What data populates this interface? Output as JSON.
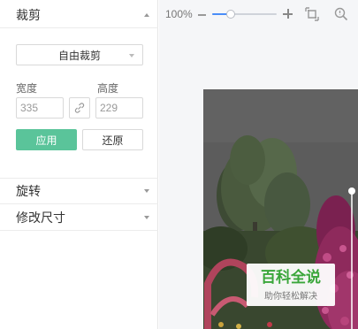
{
  "sidebar": {
    "crop": {
      "title": "裁剪",
      "mode": "自由裁剪",
      "width_label": "宽度",
      "width_value": "335",
      "height_label": "高度",
      "height_value": "229",
      "apply_label": "应用",
      "reset_label": "还原"
    },
    "rotate": {
      "title": "旋转"
    },
    "resize": {
      "title": "修改尺寸"
    }
  },
  "toolbar": {
    "zoom": "100%",
    "zoom_level": 0.25
  },
  "watermark": {
    "title": "百科全说",
    "subtitle": "助你轻松解决"
  },
  "icons": [
    "chevron-up-icon",
    "chevron-down-icon",
    "link-icon",
    "crop-icon",
    "zoom-icon",
    "minus-icon",
    "plus-icon"
  ],
  "colors": {
    "accent": "#5ac49a",
    "slider": "#4a8df8",
    "watermark": "#3aa63a"
  }
}
